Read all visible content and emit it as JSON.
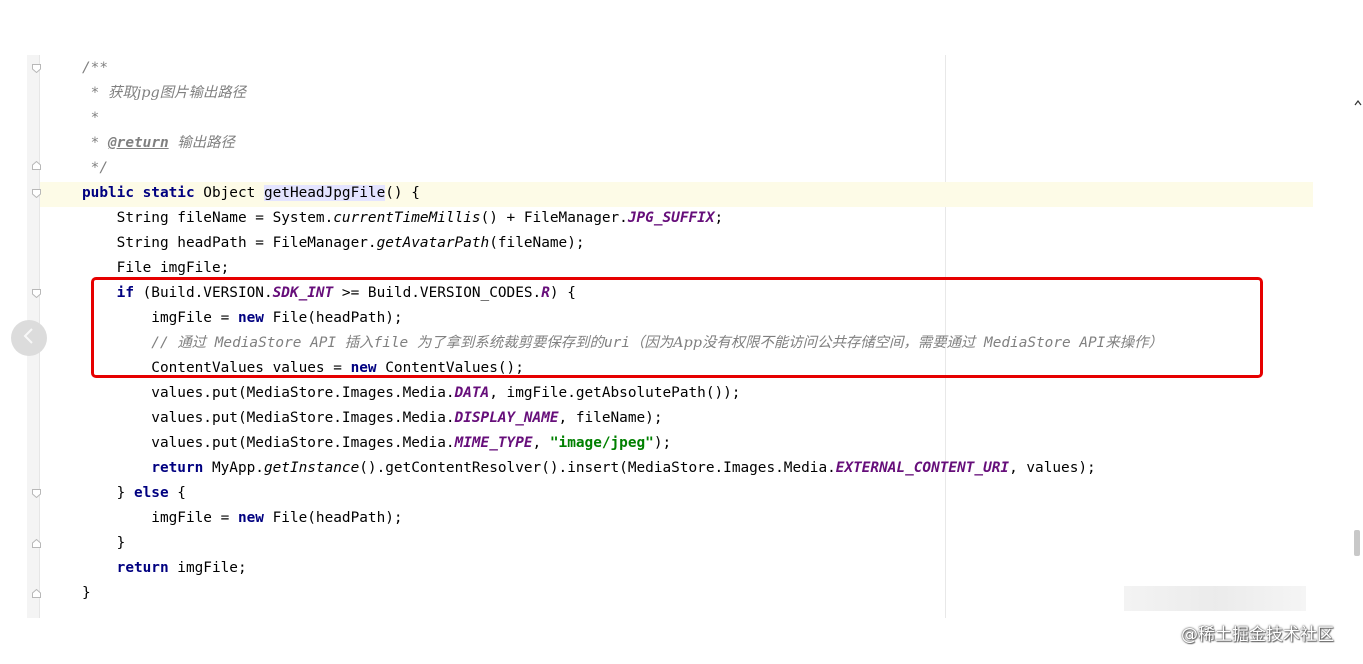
{
  "code_lines": [
    [
      {
        "t": "/**",
        "c": "cm"
      }
    ],
    [
      {
        "t": " * ",
        "c": "cm"
      },
      {
        "t": "获取jpg图片输出路径",
        "c": "cm cm-han"
      }
    ],
    [
      {
        "t": " *",
        "c": "cm"
      }
    ],
    [
      {
        "t": " * ",
        "c": "cm"
      },
      {
        "t": "@return",
        "c": "tag"
      },
      {
        "t": " ",
        "c": "cm"
      },
      {
        "t": "输出路径",
        "c": "cm cm-han"
      }
    ],
    [
      {
        "t": " */",
        "c": "cm"
      }
    ],
    [
      {
        "t": "public static",
        "c": "kw"
      },
      {
        "t": " Object ",
        "c": "nm"
      },
      {
        "t": "getHeadJpgFile",
        "c": "nm hl"
      },
      {
        "t": "() {",
        "c": "nm"
      }
    ],
    [
      {
        "t": "    String fileName = System.",
        "c": "nm"
      },
      {
        "t": "currentTimeMillis",
        "c": "fn"
      },
      {
        "t": "() + FileManager.",
        "c": "nm"
      },
      {
        "t": "JPG_SUFFIX",
        "c": "stb"
      },
      {
        "t": ";",
        "c": "nm"
      }
    ],
    [
      {
        "t": "    String headPath = FileManager.",
        "c": "nm"
      },
      {
        "t": "getAvatarPath",
        "c": "fn"
      },
      {
        "t": "(fileName);",
        "c": "nm"
      }
    ],
    [
      {
        "t": "    File imgFile;",
        "c": "nm"
      }
    ],
    [
      {
        "t": "    ",
        "c": "nm"
      },
      {
        "t": "if",
        "c": "kw"
      },
      {
        "t": " (Build.VERSION.",
        "c": "nm"
      },
      {
        "t": "SDK_INT",
        "c": "stb"
      },
      {
        "t": " >= Build.VERSION_CODES.",
        "c": "nm"
      },
      {
        "t": "R",
        "c": "stb"
      },
      {
        "t": ") {",
        "c": "nm"
      }
    ],
    [
      {
        "t": "        imgFile = ",
        "c": "nm"
      },
      {
        "t": "new",
        "c": "kw"
      },
      {
        "t": " File(headPath);",
        "c": "nm"
      }
    ],
    [
      {
        "t": "        // ",
        "c": "cm"
      },
      {
        "t": "通过",
        "c": "cm cm-han"
      },
      {
        "t": " MediaStore API ",
        "c": "cm"
      },
      {
        "t": "插入",
        "c": "cm cm-han"
      },
      {
        "t": "file ",
        "c": "cm"
      },
      {
        "t": "为了拿到系统裁剪要保存到的",
        "c": "cm cm-han"
      },
      {
        "t": "uri",
        "c": "cm"
      },
      {
        "t": "（因为App没有权限不能访问公共存储空间，需要通过",
        "c": "cm cm-han"
      },
      {
        "t": " MediaStore API",
        "c": "cm"
      },
      {
        "t": "来操作）",
        "c": "cm cm-han"
      }
    ],
    [
      {
        "t": "        ContentValues values = ",
        "c": "nm"
      },
      {
        "t": "new",
        "c": "kw"
      },
      {
        "t": " ContentValues();",
        "c": "nm"
      }
    ],
    [
      {
        "t": "        values.put(MediaStore.Images.Media.",
        "c": "nm"
      },
      {
        "t": "DATA",
        "c": "stb"
      },
      {
        "t": ", imgFile.getAbsolutePath());",
        "c": "nm"
      }
    ],
    [
      {
        "t": "        values.put(MediaStore.Images.Media.",
        "c": "nm"
      },
      {
        "t": "DISPLAY_NAME",
        "c": "stb"
      },
      {
        "t": ", fileName);",
        "c": "nm"
      }
    ],
    [
      {
        "t": "        values.put(MediaStore.Images.Media.",
        "c": "nm"
      },
      {
        "t": "MIME_TYPE",
        "c": "stb"
      },
      {
        "t": ", ",
        "c": "nm"
      },
      {
        "t": "\"image/jpeg\"",
        "c": "str"
      },
      {
        "t": ");",
        "c": "nm"
      }
    ],
    [
      {
        "t": "        ",
        "c": "nm"
      },
      {
        "t": "return",
        "c": "kw"
      },
      {
        "t": " MyApp.",
        "c": "nm"
      },
      {
        "t": "getInstance",
        "c": "fn"
      },
      {
        "t": "().getContentResolver().insert(MediaStore.Images.Media.",
        "c": "nm"
      },
      {
        "t": "EXTERNAL_CONTENT_URI",
        "c": "stb"
      },
      {
        "t": ", values);",
        "c": "nm"
      }
    ],
    [
      {
        "t": "    } ",
        "c": "nm"
      },
      {
        "t": "else",
        "c": "kw"
      },
      {
        "t": " {",
        "c": "nm"
      }
    ],
    [
      {
        "t": "        imgFile = ",
        "c": "nm"
      },
      {
        "t": "new",
        "c": "kw"
      },
      {
        "t": " File(headPath);",
        "c": "nm"
      }
    ],
    [
      {
        "t": "    }",
        "c": "nm"
      }
    ],
    [
      {
        "t": "    ",
        "c": "nm"
      },
      {
        "t": "return",
        "c": "kw"
      },
      {
        "t": " imgFile;",
        "c": "nm"
      }
    ],
    [
      {
        "t": "}",
        "c": "nm"
      }
    ]
  ],
  "watermark": "@稀土掘金技术社区",
  "icons": {
    "fold_open": "fold-open-icon",
    "fold_close": "fold-close-icon",
    "back": "chevron-left-icon"
  },
  "colors": {
    "keyword": "#000080",
    "comment": "#808080",
    "static_field": "#660e7a",
    "string": "#008000",
    "highlight_box": "#e60000",
    "current_line": "#fdfbe7"
  }
}
